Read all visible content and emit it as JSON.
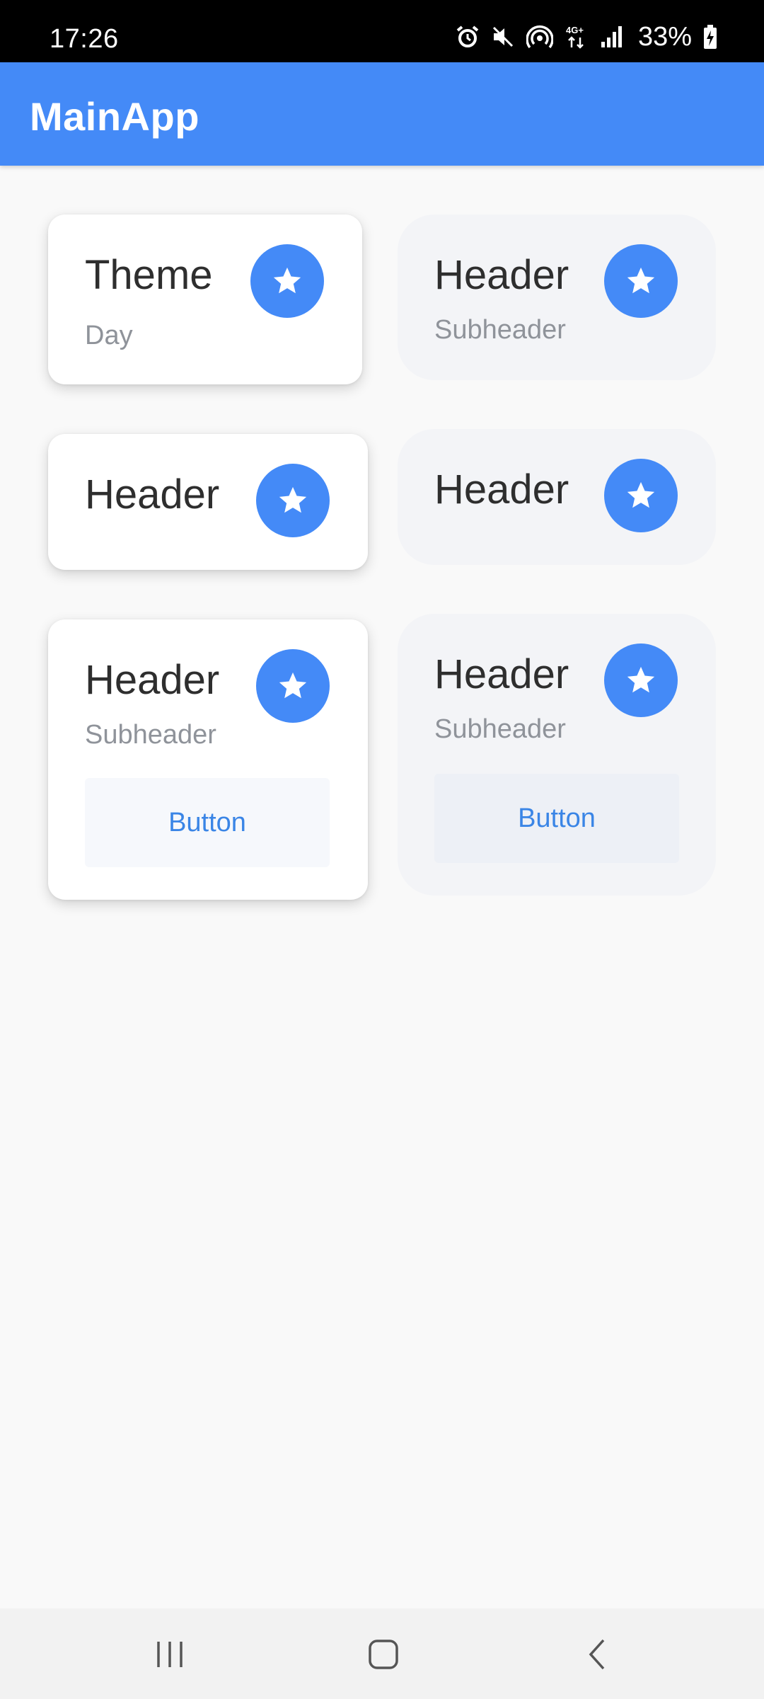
{
  "status_bar": {
    "time": "17:26",
    "battery": "33%",
    "icons": [
      "alarm-icon",
      "mute-icon",
      "hotspot-icon",
      "network-4g-icon",
      "signal-icon",
      "battery-charging-icon"
    ]
  },
  "app_bar": {
    "title": "MainApp"
  },
  "colors": {
    "accent": "#448af7",
    "button_text": "#3a85e6",
    "elevated_card": "#ffffff",
    "flat_card": "#f3f4f7"
  },
  "cards": [
    {
      "header": "Theme",
      "subheader": "Day",
      "icon": "star-icon"
    },
    {
      "header": "Header",
      "subheader": "Subheader",
      "icon": "star-icon"
    },
    {
      "header": "Header",
      "icon": "star-icon"
    },
    {
      "header": "Header",
      "icon": "star-icon"
    },
    {
      "header": "Header",
      "subheader": "Subheader",
      "button": "Button",
      "icon": "star-icon"
    },
    {
      "header": "Header",
      "subheader": "Subheader",
      "button": "Button",
      "icon": "star-icon"
    }
  ],
  "nav_bar": {
    "icons": [
      "recent-apps-icon",
      "home-icon",
      "back-icon"
    ]
  }
}
